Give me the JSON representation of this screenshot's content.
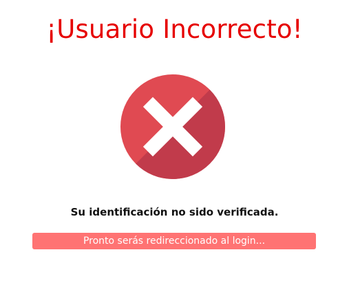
{
  "heading": {
    "title": "¡Usuario Incorrecto!"
  },
  "status": {
    "icon": "error-x-icon",
    "message": "Su identificación no sido verificada."
  },
  "redirect": {
    "text": "Pronto serás redireccionado al login..."
  },
  "colors": {
    "title": "#e60000",
    "circle_light": "#e04a52",
    "circle_dark": "#c13b4b",
    "cross": "#ffffff",
    "redirect_bg": "#ff7373",
    "redirect_text": "#ffffff"
  }
}
